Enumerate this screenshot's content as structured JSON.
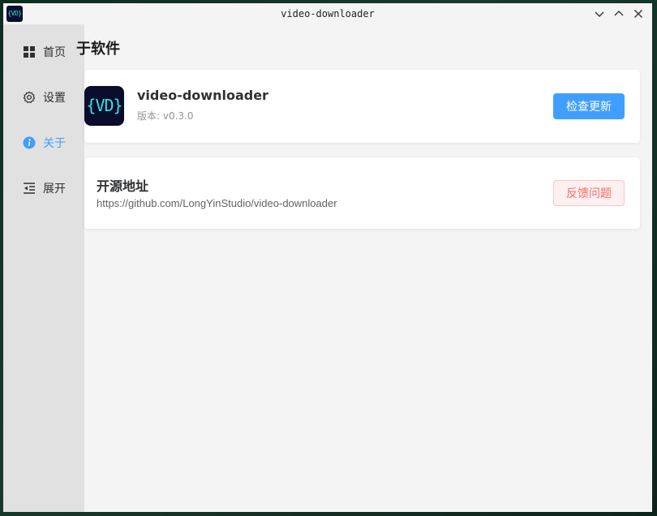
{
  "window": {
    "title": "video-downloader",
    "icon_text": "{VD}"
  },
  "sidebar": {
    "items": [
      {
        "label": "首页",
        "icon": "grid-icon",
        "active": false
      },
      {
        "label": "设置",
        "icon": "gear-icon",
        "active": false
      },
      {
        "label": "关于",
        "icon": "info-icon",
        "active": true
      },
      {
        "label": "展开",
        "icon": "expand-icon",
        "active": false
      }
    ]
  },
  "page": {
    "title": "于软件"
  },
  "about_card": {
    "logo_text": "{VD}",
    "app_name": "video-downloader",
    "version": "版本: v0.3.0",
    "check_update_label": "检查更新"
  },
  "source_card": {
    "title": "开源地址",
    "url": "https://github.com/LongYinStudio/video-downloader",
    "feedback_label": "反馈问题"
  },
  "colors": {
    "accent": "#409eff",
    "danger": "#f56c6c",
    "sidebar_bg": "#e1e1e1",
    "content_bg": "#f4f4f4"
  }
}
